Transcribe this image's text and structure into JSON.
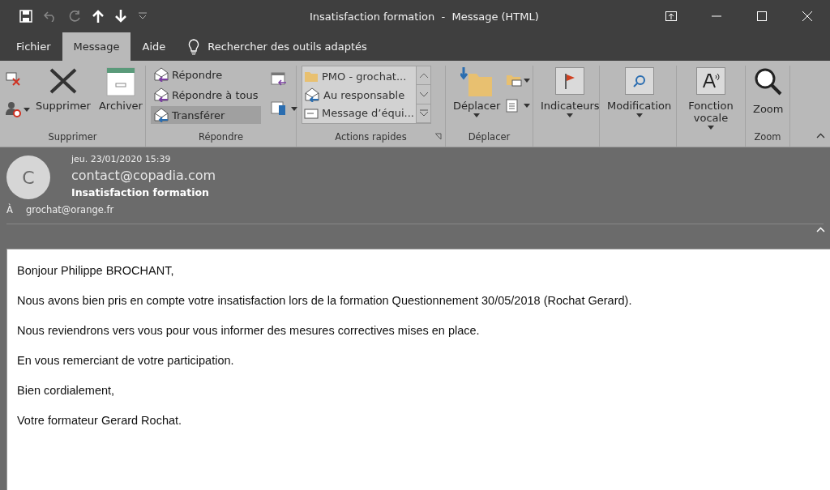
{
  "window": {
    "title": "Insatisfaction formation  -  Message (HTML)"
  },
  "tabs": [
    {
      "label": "Fichier",
      "selected": false
    },
    {
      "label": "Message",
      "selected": true
    },
    {
      "label": "Aide",
      "selected": false
    }
  ],
  "tell_me": {
    "placeholder": "Rechercher des outils adaptés"
  },
  "ribbon": [
    {
      "kind": "delete",
      "label": "Supprimer",
      "buttons": [
        {
          "label": "Supprimer"
        },
        {
          "label": "Archiver"
        }
      ]
    },
    {
      "kind": "respond",
      "label": "Répondre",
      "buttons": [
        {
          "label": "Répondre",
          "selected": false
        },
        {
          "label": "Répondre à tous",
          "selected": false
        },
        {
          "label": "Transférer",
          "selected": true
        }
      ]
    },
    {
      "kind": "quicksteps",
      "label": "Actions rapides",
      "buttons": [
        {
          "label": "PMO - grochat..."
        },
        {
          "label": "Au responsable"
        },
        {
          "label": "Message d’équi..."
        }
      ]
    },
    {
      "kind": "move",
      "label": "Déplacer",
      "buttons": [
        {
          "label": "Déplacer"
        }
      ]
    },
    {
      "kind": "tags",
      "buttons": [
        {
          "label": "Indicateurs"
        }
      ]
    },
    {
      "kind": "editing",
      "buttons": [
        {
          "label": "Modification"
        }
      ]
    },
    {
      "kind": "speech",
      "buttons": [
        {
          "label": "Fonction vocale"
        }
      ]
    },
    {
      "kind": "zoom",
      "label": "Zoom",
      "buttons": [
        {
          "label": "Zoom"
        }
      ]
    }
  ],
  "message": {
    "avatar": "C",
    "date": "jeu. 23/01/2020 15:39",
    "sender": "contact@copadia.com",
    "subject": "Insatisfaction formation",
    "to_label": "À",
    "to": "grochat@orange.fr",
    "body": [
      "Bonjour Philippe BROCHANT,",
      "Nous avons bien pris en compte votre insatisfaction lors de la formation Questionnement 30/05/2018 (Rochat Gerard).",
      "Nous reviendrons vers vous pour vous informer des mesures correctives mises en place.",
      "En vous remerciant de votre participation.",
      "Bien cordialement,",
      "Votre formateur Gerard Rochat."
    ]
  }
}
